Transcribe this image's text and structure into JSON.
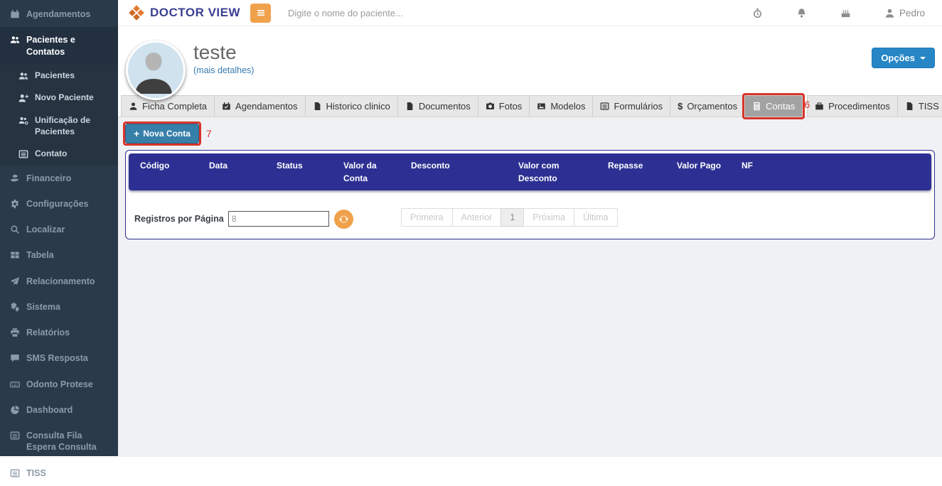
{
  "app": {
    "brand": "DOCTOR VIEW"
  },
  "topbar": {
    "search_placeholder": "Digite o nome do paciente...",
    "user": "Pedro",
    "icons": [
      "stopwatch-icon",
      "bell-icon",
      "birthday-cake-icon",
      "user-icon"
    ]
  },
  "sidebar": {
    "items": [
      {
        "label": "Agendamentos",
        "icon": "calendar-icon"
      },
      {
        "label": "Pacientes e Contatos",
        "icon": "users-icon",
        "active": true
      },
      {
        "label": "Pacientes",
        "icon": "users-icon",
        "sub": true
      },
      {
        "label": "Novo Paciente",
        "icon": "user-plus-icon",
        "sub": true
      },
      {
        "label": "Unificação de Pacientes",
        "icon": "users-gear-icon",
        "sub": true
      },
      {
        "label": "Contato",
        "icon": "list-icon",
        "sub": true
      },
      {
        "label": "Financeiro",
        "icon": "money-icon"
      },
      {
        "label": "Configurações",
        "icon": "gear-icon"
      },
      {
        "label": "Localizar",
        "icon": "search-icon"
      },
      {
        "label": "Tabela",
        "icon": "table-icon"
      },
      {
        "label": "Relacionamento",
        "icon": "paper-plane-icon"
      },
      {
        "label": "Sistema",
        "icon": "gears-icon"
      },
      {
        "label": "Relatórios",
        "icon": "printer-icon"
      },
      {
        "label": "SMS Resposta",
        "icon": "comment-icon"
      },
      {
        "label": "Odonto Protese",
        "icon": "keyboard-icon"
      },
      {
        "label": "Dashboard",
        "icon": "pie-chart-icon"
      },
      {
        "label": "Consulta Fila Espera Consulta",
        "icon": "list-icon"
      },
      {
        "label": "TISS",
        "icon": "list-icon"
      }
    ]
  },
  "patient": {
    "name": "teste",
    "details_link": "(mais detalhes)",
    "options_button": "Opções"
  },
  "tabs": [
    {
      "label": "Ficha Completa",
      "icon": "user-icon"
    },
    {
      "label": "Agendamentos",
      "icon": "calendar-check-icon"
    },
    {
      "label": "Historico clinico",
      "icon": "file-icon"
    },
    {
      "label": "Documentos",
      "icon": "file-icon"
    },
    {
      "label": "Fotos",
      "icon": "camera-icon"
    },
    {
      "label": "Modelos",
      "icon": "image-icon"
    },
    {
      "label": "Formulários",
      "icon": "form-icon"
    },
    {
      "label": "Orçamentos",
      "icon": "dollar-icon"
    },
    {
      "label": "Contas",
      "icon": "calculator-icon",
      "active": true
    },
    {
      "label": "Procedimentos",
      "icon": "briefcase-icon"
    },
    {
      "label": "TISS",
      "icon": "file-icon"
    }
  ],
  "annotations": {
    "contas_marker": "6",
    "nova_conta_marker": "7"
  },
  "accounts": {
    "new_button": "Nova Conta",
    "table": {
      "columns": [
        "Código",
        "Data",
        "Status",
        "Valor da Conta",
        "Desconto",
        "Valor com Desconto",
        "Repasse",
        "Valor Pago",
        "NF"
      ],
      "rows": []
    },
    "records_label": "Registros por Página",
    "records_value": "8",
    "pagination": {
      "first": "Primeira",
      "prev": "Anterior",
      "current": "1",
      "next": "Próxima",
      "last": "Última"
    }
  },
  "icons": {
    "plus_glyph": "+",
    "dollar_glyph": "$"
  },
  "colors": {
    "sidebar_bg": "#2b3a4a",
    "table_header_blue": "#2d3092",
    "accent_orange": "#f0a14b",
    "annotation_red": "#d9342b",
    "new_button_blue": "#367fa9",
    "options_button_blue": "#2786c6",
    "brand_navy": "#3a3f92"
  }
}
